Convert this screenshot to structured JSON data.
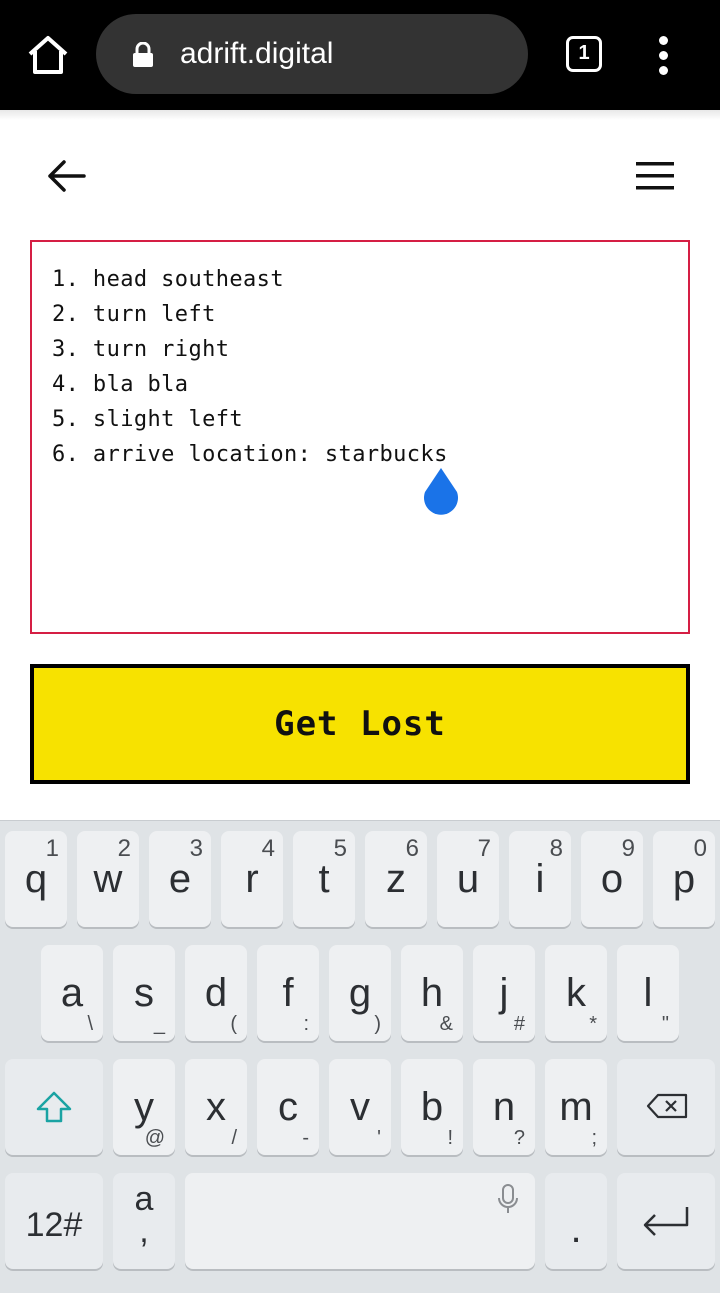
{
  "browser": {
    "url": "adrift.digital",
    "tab_count": "1",
    "icons": {
      "home": "home-icon",
      "lock": "lock-icon",
      "menu": "overflow-menu-icon"
    }
  },
  "app": {
    "back_icon": "arrow-left-icon",
    "menu_icon": "hamburger-icon",
    "directions": [
      "1. head southeast",
      "2. turn left",
      "3. turn right",
      "4. bla bla",
      "5. slight left",
      "6. arrive location: starbucks"
    ],
    "button_label": "Get Lost",
    "colors": {
      "box_border": "#d51e44",
      "button_bg": "#f7e200",
      "cursor_handle": "#1a73e8"
    }
  },
  "keyboard": {
    "row1": [
      {
        "key": "q",
        "hint": "1"
      },
      {
        "key": "w",
        "hint": "2"
      },
      {
        "key": "e",
        "hint": "3"
      },
      {
        "key": "r",
        "hint": "4"
      },
      {
        "key": "t",
        "hint": "5"
      },
      {
        "key": "z",
        "hint": "6"
      },
      {
        "key": "u",
        "hint": "7"
      },
      {
        "key": "i",
        "hint": "8"
      },
      {
        "key": "o",
        "hint": "9"
      },
      {
        "key": "p",
        "hint": "0"
      }
    ],
    "row2": [
      {
        "key": "a",
        "sub": "\\"
      },
      {
        "key": "s",
        "sub": "_"
      },
      {
        "key": "d",
        "sub": "("
      },
      {
        "key": "f",
        "sub": ":"
      },
      {
        "key": "g",
        "sub": ")"
      },
      {
        "key": "h",
        "sub": "&"
      },
      {
        "key": "j",
        "sub": "#"
      },
      {
        "key": "k",
        "sub": "*"
      },
      {
        "key": "l",
        "sub": "\""
      }
    ],
    "row3": [
      {
        "key": "y",
        "sub": "@"
      },
      {
        "key": "x",
        "sub": "/"
      },
      {
        "key": "c",
        "sub": "-"
      },
      {
        "key": "v",
        "sub": "'"
      },
      {
        "key": "b",
        "sub": "!"
      },
      {
        "key": "n",
        "sub": "?"
      },
      {
        "key": "m",
        "sub": ";"
      }
    ],
    "numbers_label": "12#",
    "emoji_key_main": "a",
    "emoji_key_sub": ",",
    "period_label": ".",
    "icons": {
      "shift": "shift-icon",
      "backspace": "backspace-icon",
      "mic": "microphone-icon",
      "enter": "enter-icon"
    }
  }
}
